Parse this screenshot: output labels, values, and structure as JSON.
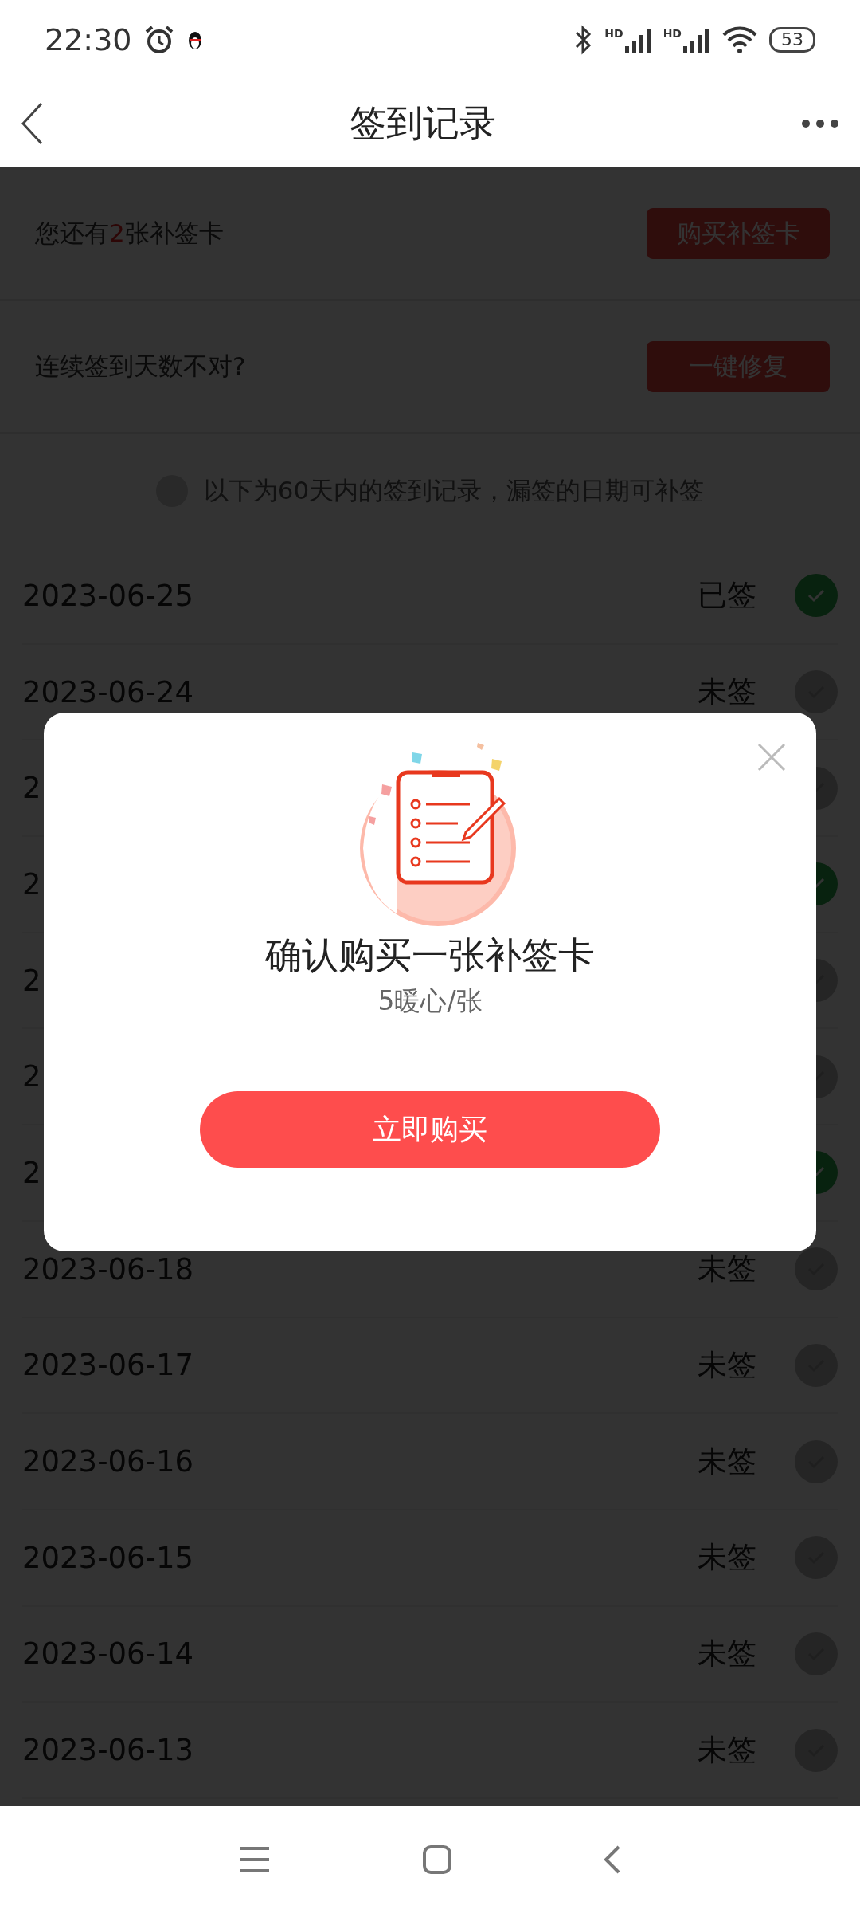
{
  "status_bar": {
    "time": "22:30",
    "signal_labels": [
      "HD",
      "HD"
    ],
    "battery": "53"
  },
  "header": {
    "title": "签到记录"
  },
  "cards_summary": {
    "text": "您还有**2**张补签卡",
    "button": "购买补签卡"
  },
  "repair": {
    "text": "连续签到天数不对?",
    "button": "一键修复"
  },
  "notice": "以下为60天内的签到记录，漏签的日期可补签",
  "records": [
    {
      "date": "2023-06-25",
      "status": "已签",
      "signed": true
    },
    {
      "date": "2023-06-24",
      "status": "未签",
      "signed": false
    },
    {
      "date": "2",
      "signed": false
    },
    {
      "date": "2",
      "signed": true
    },
    {
      "date": "2",
      "signed": false
    },
    {
      "date": "2",
      "signed": false
    },
    {
      "date": "2",
      "signed": true
    },
    {
      "date": "2023-06-18",
      "status": "未签",
      "signed": false
    },
    {
      "date": "2023-06-17",
      "status": "未签",
      "signed": false
    },
    {
      "date": "2023-06-16",
      "status": "未签",
      "signed": false
    },
    {
      "date": "2023-06-15",
      "status": "未签",
      "signed": false
    },
    {
      "date": "2023-06-14",
      "status": "未签",
      "signed": false
    },
    {
      "date": "2023-06-13",
      "status": "未签",
      "signed": false
    }
  ],
  "dialog": {
    "title": "确认购买一张补签卡",
    "price": "5暖心/张",
    "button": "立即购买"
  }
}
